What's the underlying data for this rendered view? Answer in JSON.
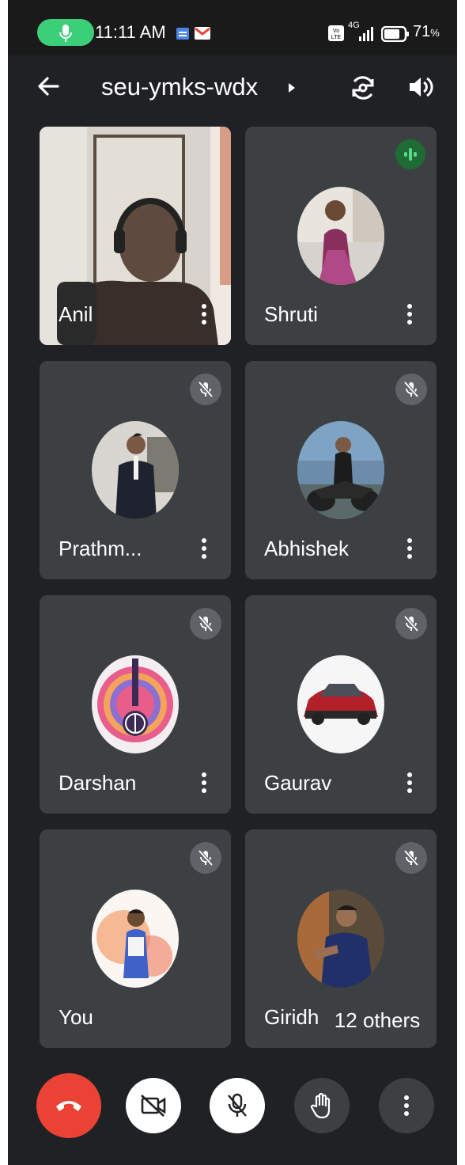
{
  "status_bar": {
    "time": "11:11 AM",
    "network": "4G",
    "battery": "71",
    "battery_unit": "%",
    "icons": [
      "mic-active-icon",
      "calendar-icon",
      "gmail-icon",
      "volte-icon",
      "signal-icon",
      "battery-icon"
    ]
  },
  "header": {
    "meeting_code": "seu-ymks-wdx",
    "icons": [
      "back-arrow-icon",
      "caret-right-icon",
      "switch-camera-icon",
      "speaker-icon"
    ]
  },
  "participants": [
    {
      "name": "Anil",
      "video_on": true,
      "muted": false
    },
    {
      "name": "Shruti",
      "video_on": false,
      "muted": false,
      "speaking": true
    },
    {
      "name": "Prathm...",
      "video_on": false,
      "muted": true
    },
    {
      "name": "Abhishek",
      "video_on": false,
      "muted": true
    },
    {
      "name": "Darshan",
      "video_on": false,
      "muted": true
    },
    {
      "name": "Gaurav",
      "video_on": false,
      "muted": true
    },
    {
      "name": "You",
      "video_on": false,
      "muted": true
    },
    {
      "name": "Giridh",
      "video_on": false,
      "muted": true
    }
  ],
  "others_chip": "12 others",
  "controls": [
    {
      "name": "end-call",
      "icon": "phone-hangup-icon",
      "color": "#ea4335"
    },
    {
      "name": "camera-toggle",
      "icon": "camera-off-icon",
      "color": "#ffffff"
    },
    {
      "name": "mic-toggle",
      "icon": "mic-off-icon",
      "color": "#ffffff"
    },
    {
      "name": "raise-hand",
      "icon": "hand-icon",
      "color": "#3c4043"
    },
    {
      "name": "more-options",
      "icon": "more-vert-icon",
      "color": "#3c4043"
    }
  ],
  "colors": {
    "background": "#202124",
    "tile": "#3c4043",
    "accent_green": "#3ccf79",
    "end_call_red": "#ea4335"
  }
}
